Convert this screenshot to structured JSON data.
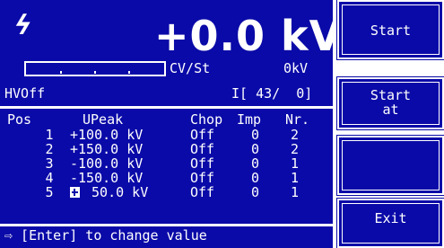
{
  "status": {
    "hv_icon": "lightning-bolt-icon",
    "voltage": "+0.0 kV",
    "control_mode": "CV/St",
    "setpoint": "0kV",
    "hv_state": "HVOff",
    "counter": "I[ 43/  0]",
    "progress_fraction": 0.0
  },
  "table": {
    "headers": {
      "pos": "Pos",
      "upeak": "UPeak",
      "chop": "Chop",
      "imp": "Imp",
      "nr": "Nr."
    },
    "rows": [
      {
        "pos": "1",
        "upeak": "+100.0 kV",
        "chop": "Off",
        "imp": "0",
        "nr": "2"
      },
      {
        "pos": "2",
        "upeak": "+150.0 kV",
        "chop": "Off",
        "imp": "0",
        "nr": "2"
      },
      {
        "pos": "3",
        "upeak": "-100.0 kV",
        "chop": "Off",
        "imp": "0",
        "nr": "1"
      },
      {
        "pos": "4",
        "upeak": "-150.0 kV",
        "chop": "Off",
        "imp": "0",
        "nr": "1"
      },
      {
        "pos": "5",
        "upeak": " 50.0 kV",
        "chop": "Off",
        "imp": "0",
        "nr": "1"
      }
    ]
  },
  "hint": "⇨ [Enter] to change value",
  "softkeys": {
    "start": "Start",
    "start_at_line1": "Start",
    "start_at_line2": "at",
    "blank": "",
    "exit": "Exit"
  },
  "colors": {
    "lcd_background": "#0a0aa8",
    "foreground": "#ffffff"
  }
}
